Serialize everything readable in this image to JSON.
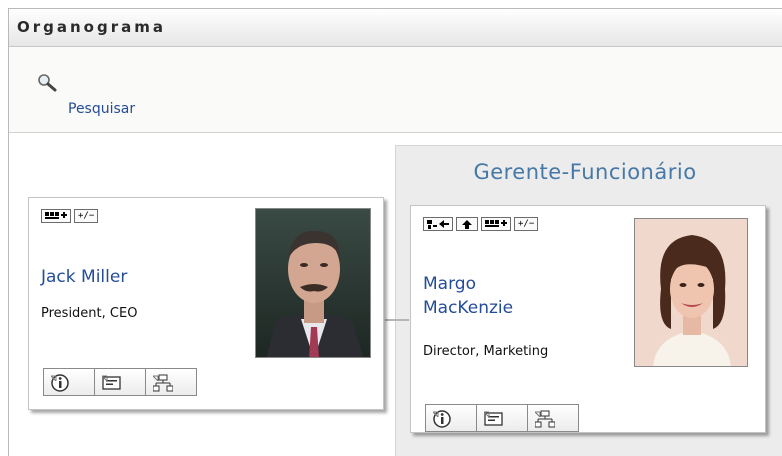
{
  "window": {
    "title": "Organograma"
  },
  "search": {
    "label": "Pesquisar",
    "icon": "magnifier-icon"
  },
  "panel": {
    "title": "Gerente-Funcionário"
  },
  "cards": [
    {
      "name": "Jack Miller",
      "role": "President, CEO",
      "toolbar": [
        "expand-reports-icon",
        "plus-minus-toggle"
      ],
      "toolbar_text": {
        "toggle": "+/−"
      },
      "actions": [
        "info-icon",
        "card-icon",
        "org-chart-icon"
      ]
    },
    {
      "name_line1": "Margo",
      "name_line2": "MacKenzie",
      "role": "Director, Marketing",
      "toolbar": [
        "back-to-manager-icon",
        "up-arrow-icon",
        "expand-reports-icon",
        "plus-minus-toggle"
      ],
      "toolbar_text": {
        "toggle": "+/−"
      },
      "actions": [
        "info-icon",
        "card-icon",
        "org-chart-icon"
      ]
    }
  ],
  "colors": {
    "link": "#254c98",
    "panel_title": "#4678a8",
    "panel_bg": "#ececec"
  }
}
